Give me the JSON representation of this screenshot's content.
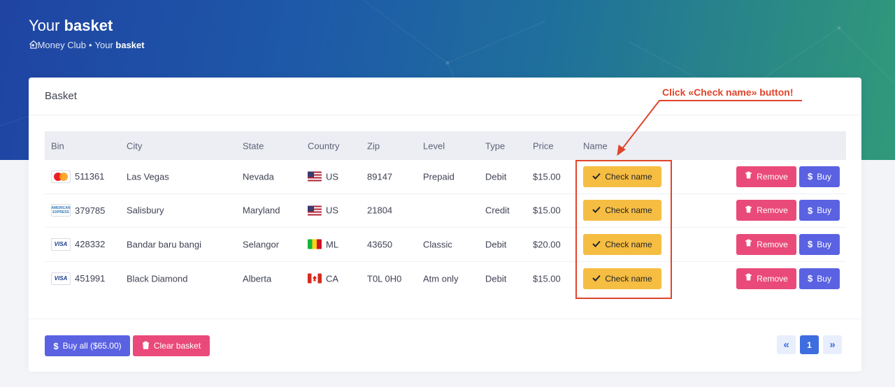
{
  "header": {
    "title_prefix": "Your",
    "title_bold": "basket",
    "breadcrumb": {
      "home_icon": "home-icon",
      "sep": "•",
      "item1": "Money Club",
      "item2_prefix": "Your",
      "item2_bold": "basket"
    }
  },
  "card": {
    "title": "Basket",
    "columns": {
      "bin": "Bin",
      "city": "City",
      "state": "State",
      "country": "Country",
      "zip": "Zip",
      "level": "Level",
      "type": "Type",
      "price": "Price",
      "name": "Name"
    },
    "rows": [
      {
        "brand": "mastercard",
        "bin": "511361",
        "city": "Las Vegas",
        "state": "Nevada",
        "flag": "us",
        "country": "US",
        "zip": "89147",
        "level": "Prepaid",
        "type": "Debit",
        "price": "$15.00",
        "check_label": "Check name",
        "remove_label": "Remove",
        "buy_label": "Buy"
      },
      {
        "brand": "amex",
        "bin": "379785",
        "city": "Salisbury",
        "state": "Maryland",
        "flag": "us",
        "country": "US",
        "zip": "21804",
        "level": "",
        "type": "Credit",
        "price": "$15.00",
        "check_label": "Check name",
        "remove_label": "Remove",
        "buy_label": "Buy"
      },
      {
        "brand": "visa",
        "bin": "428332",
        "city": "Bandar baru bangi",
        "state": "Selangor",
        "flag": "ml",
        "country": "ML",
        "zip": "43650",
        "level": "Classic",
        "type": "Debit",
        "price": "$20.00",
        "check_label": "Check name",
        "remove_label": "Remove",
        "buy_label": "Buy"
      },
      {
        "brand": "visa",
        "bin": "451991",
        "city": "Black Diamond",
        "state": "Alberta",
        "flag": "ca",
        "country": "CA",
        "zip": "T0L 0H0",
        "level": "Atm only",
        "type": "Debit",
        "price": "$15.00",
        "check_label": "Check name",
        "remove_label": "Remove",
        "buy_label": "Buy"
      }
    ],
    "brand_text": {
      "visa": "VISA",
      "amex_top": "AMERICAN",
      "amex_bottom": "EXPRESS"
    },
    "footer": {
      "buy_all_label": "Buy all ($65.00)",
      "clear_label": "Clear basket",
      "pager": {
        "prev": "«",
        "current": "1",
        "next": "»"
      }
    }
  },
  "annotation": {
    "text": "Click «Check name» button!",
    "color": "#e0452a"
  },
  "colors": {
    "check": "#f6bd43",
    "remove": "#e94a79",
    "buy": "#5a62e2",
    "pager": "#3e6de0"
  }
}
